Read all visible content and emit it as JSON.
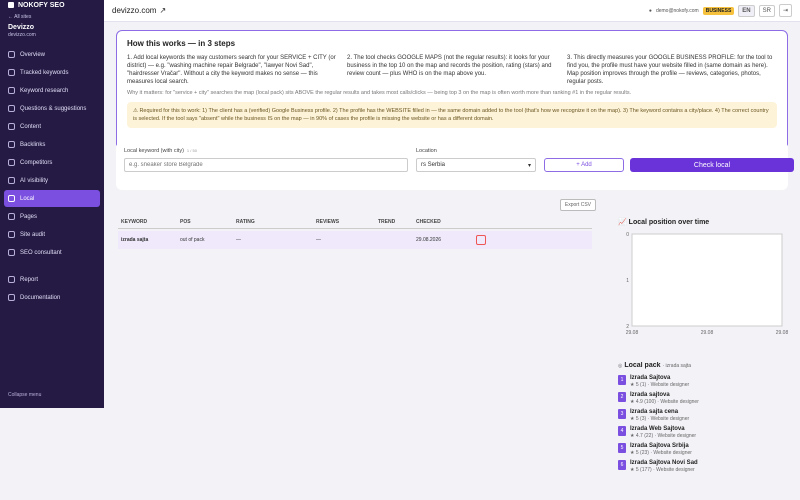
{
  "brand": "NOKOFY SEO",
  "sidebar": {
    "all_sites": "← All sites",
    "site_name": "Devizzo",
    "site_domain": "devizzo.com",
    "items": [
      {
        "label": "Overview"
      },
      {
        "label": "Tracked keywords"
      },
      {
        "label": "Keyword research"
      },
      {
        "label": "Questions & suggestions"
      },
      {
        "label": "Content"
      },
      {
        "label": "Backlinks"
      },
      {
        "label": "Competitors"
      },
      {
        "label": "AI visibility"
      },
      {
        "label": "Local"
      },
      {
        "label": "Pages"
      },
      {
        "label": "Site audit"
      },
      {
        "label": "SEO consultant"
      },
      {
        "label": "Report"
      },
      {
        "label": "Documentation"
      }
    ],
    "collapse": "Collapse menu"
  },
  "topbar": {
    "domain": "devizzo.com",
    "user": "demo@nokofy.com",
    "plan": "BUSINESS",
    "lang_en": "EN",
    "lang_sr": "SR"
  },
  "how": {
    "title": "How this works — in 3 steps",
    "step1": "1. Add local keywords the way customers search for your SERVICE + CITY (or district) — e.g. \"washing machine repair Belgrade\", \"lawyer Novi Sad\", \"hairdresser Vračar\". Without a city the keyword makes no sense — this measures local search.",
    "step2": "2. The tool checks GOOGLE MAPS (not the regular results): it looks for your business in the top 10 on the map and records the position, rating (stars) and review count — plus WHO is on the map above you.",
    "step3": "3. This directly measures your GOOGLE BUSINESS PROFILE: for the tool to find you, the profile must have your website filled in (same domain as here). Map position improves through the profile — reviews, categories, photos, regular posts.",
    "why": "Why it matters: for \"service + city\" searches the map (local pack) sits ABOVE the regular results and takes most calls/clicks — being top 3 on the map is often worth more than ranking #1 in the regular results.",
    "required": "⚠ Required for this to work: 1) The client has a (verified) Google Business profile. 2) The profile has the WEBSITE filled in — the same domain added to the tool (that's how we recognize it on the map). 3) The keyword contains a city/place. 4) The correct country is selected. If the tool says \"absent\" while the business IS on the map — in 90% of cases the profile is missing the website or has a different domain."
  },
  "search": {
    "kw_label": "Local keyword (with city)",
    "kw_count": "1 / 50",
    "kw_placeholder": "e.g. sneaker store Belgrade",
    "loc_label": "Location",
    "loc_value": "rs Serbia",
    "add": "+ Add",
    "check": "Check local"
  },
  "table": {
    "export": "Export CSV",
    "headers": [
      "KEYWORD",
      "POS",
      "RATING",
      "REVIEWS",
      "TREND",
      "CHECKED"
    ],
    "rows": [
      {
        "keyword": "izrada sajta",
        "pos": "out of pack",
        "rating": "—",
        "reviews": "—",
        "trend": "",
        "checked": "29.08.2026"
      }
    ]
  },
  "chart_data": {
    "type": "line",
    "title": "Local position over time",
    "xlabel": "",
    "ylabel": "",
    "x": [
      "29.08",
      "29.08",
      "29.08"
    ],
    "y_ticks": [
      0,
      1,
      2
    ],
    "series": []
  },
  "pack": {
    "title": "Local pack",
    "keyword": "· izrada sajta",
    "items": [
      {
        "num": "1",
        "name": "Izrada Sajtova",
        "meta": "★ 5 (1) · Website designer"
      },
      {
        "num": "2",
        "name": "Izrada sajtova",
        "meta": "★ 4.9 (100) · Website designer"
      },
      {
        "num": "3",
        "name": "Izrada sajta cena",
        "meta": "★ 5 (3) · Website designer"
      },
      {
        "num": "4",
        "name": "Izrada Web Sajtova",
        "meta": "★ 4.7 (22) · Website designer"
      },
      {
        "num": "5",
        "name": "Izrada Sajtova Srbija",
        "meta": "★ 5 (23) · Website designer"
      },
      {
        "num": "6",
        "name": "Izrada Sajtova Novi Sad",
        "meta": "★ 5 (177) · Website designer"
      }
    ]
  }
}
